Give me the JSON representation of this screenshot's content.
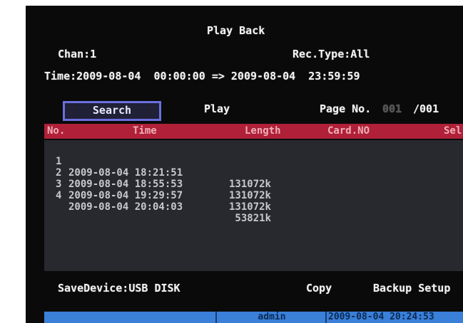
{
  "window": {
    "title": "Play Back"
  },
  "filters": {
    "chan_label": "Chan:",
    "chan_value": "1",
    "rec_type_label": "Rec.Type:",
    "rec_type_value": "All",
    "time_label": "Time:",
    "time_start": "2009-08-04  00:00:00",
    "time_arrow": "=>",
    "time_end": "2009-08-04  23:59:59"
  },
  "actions": {
    "search_label": "Search",
    "play_label": "Play",
    "copy_label": "Copy",
    "backup_label": "Backup Setup"
  },
  "pagination": {
    "label": "Page No.",
    "current": "001",
    "total": "/001"
  },
  "table": {
    "columns": [
      "No.",
      "Time",
      "Length",
      "Card.NO",
      "Sel"
    ],
    "rows": [
      {
        "no": "1",
        "time": "2009-08-04 18:21:51",
        "length": "131072k"
      },
      {
        "no": "2",
        "time": "2009-08-04 18:55:53",
        "length": "131072k"
      },
      {
        "no": "3",
        "time": "2009-08-04 19:29:57",
        "length": "131072k"
      },
      {
        "no": "4",
        "time": "2009-08-04 20:04:03",
        "length": "53821k"
      }
    ]
  },
  "device": {
    "label": "SaveDevice:",
    "value": "USB DISK"
  },
  "status_bar": {
    "user": "admin",
    "datetime": "2009-08-04 20:24:53"
  },
  "colors": {
    "screen_bg": "#0a0a0a",
    "header_bg": "#b02038",
    "list_bg": "#27292f",
    "status_bg": "#3a7fd8",
    "search_border": "#6a6fe0"
  }
}
